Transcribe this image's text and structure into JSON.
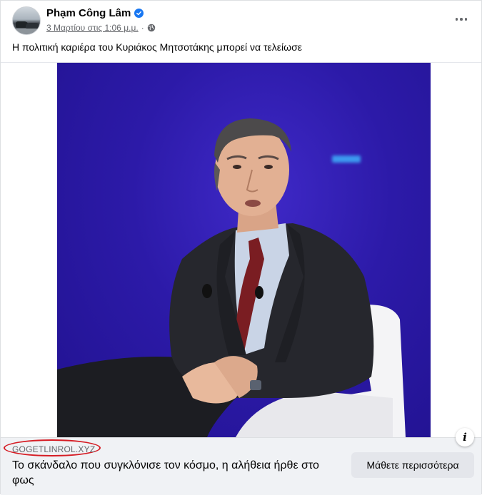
{
  "post": {
    "author": "Phạm Công Lâm",
    "verified": true,
    "timestamp": "3 Μαρτίου στις 1:06 μ.μ.",
    "separator": "·",
    "audience_icon": "globe-icon",
    "more_icon": "more-options-icon",
    "caption": "Η πολιτική καριέρα του Κυριάκος Μητσοτάκης μπορεί να τελείωσε"
  },
  "link": {
    "domain": "GOGETLINROL.XYZ",
    "headline": "Το σκάνδαλο που συγκλόνισε τον κόσμο, η αλήθεια ήρθε στο φως",
    "cta_label": "Μάθετε περισσότερα",
    "info_icon": "i"
  },
  "colors": {
    "verified": "#1877f2",
    "link_bar_bg": "#f0f2f5",
    "photo_bg": "#2c1aa8",
    "highlight_oval": "#d61c24"
  }
}
